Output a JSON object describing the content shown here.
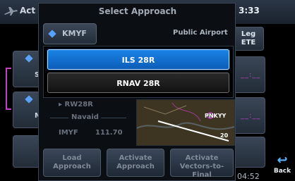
{
  "background": {
    "header_title": "Act",
    "clock": "3:33",
    "leg_label": "Leg",
    "ete_label": "ETE",
    "leg_rows": [
      "S",
      "M"
    ],
    "dashes": [
      "__:__",
      "__:__"
    ],
    "back_label": "Back",
    "elapsed": "04:52"
  },
  "modal": {
    "title": "Select Approach",
    "airport": "KMYF",
    "airport_type": "Public Airport",
    "approaches": [
      {
        "label": "ILS 28R",
        "selected": true
      },
      {
        "label": "RNAV 28R",
        "selected": false
      }
    ],
    "transition": "RW28R",
    "navaid_label": "Navaid",
    "navaid_ident": "IMYF",
    "navaid_freq": "111.70",
    "map_labels": [
      "PNKYY",
      "20"
    ],
    "buttons": [
      {
        "line1": "Load",
        "line2": "Approach"
      },
      {
        "line1": "Activate",
        "line2": "Approach"
      },
      {
        "line1": "Activate",
        "line2": "Vectors-to-Final"
      }
    ]
  },
  "colors": {
    "selected_item": "#1a83e5",
    "magenta": "#c23fc6",
    "accent_blue": "#59a3ff"
  }
}
